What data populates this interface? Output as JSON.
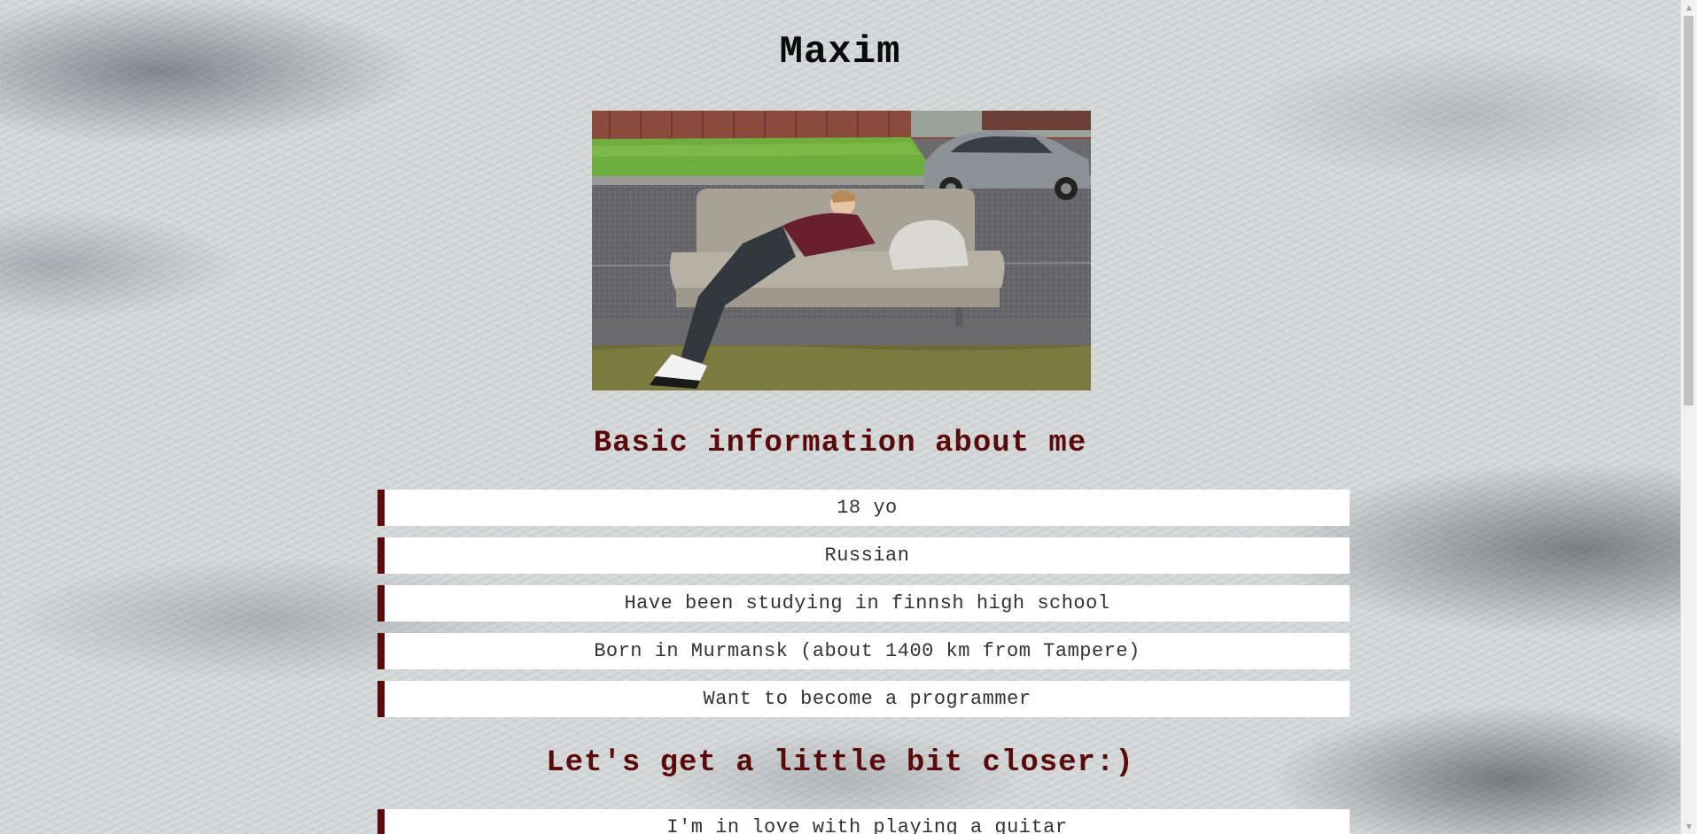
{
  "header": {
    "name": "Maxim"
  },
  "photo": {
    "icon": "portrait-photo"
  },
  "basic_section": {
    "heading": "Basic information about me",
    "items": [
      "18 yo",
      "Russian",
      "Have been studying in finnsh high school",
      "Born in Murmansk (about 1400 km from Tampere)",
      "Want to become a programmer"
    ]
  },
  "closer_section": {
    "heading": "Let's get a little bit closer:)",
    "items": [
      "I'm in love with playing a guitar"
    ]
  },
  "scrollbar": {
    "up_icon": "arrow-up-icon",
    "down_icon": "arrow-down-icon"
  },
  "colors": {
    "accent": "#5f0a0a",
    "heading": "#5a0a0a",
    "title": "#0a0a0a",
    "item_bg": "#ffffff"
  }
}
